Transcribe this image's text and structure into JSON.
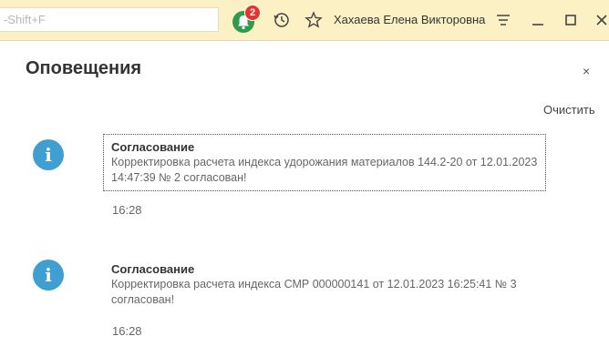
{
  "toolbar": {
    "search_hint": "-Shift+F",
    "notification_count": "2",
    "user_name": "Хахаева Елена Викторовна",
    "accent": "#fbf1c4"
  },
  "panel": {
    "title": "Оповещения",
    "close_label": "×",
    "clear_label": "Очистить"
  },
  "notifications": [
    {
      "icon": "info-icon",
      "title": "Согласование",
      "text": "Корректировка расчета индекса удорожания материалов 144.2-20  от 12.01.2023 14:47:39 № 2 согласован!",
      "time": "16:28"
    },
    {
      "icon": "info-icon",
      "title": "Согласование",
      "text": "Корректировка расчета индекса СМР 000000141 от 12.01.2023 16:25:41 № 3 согласован!",
      "time": "16:28"
    }
  ]
}
